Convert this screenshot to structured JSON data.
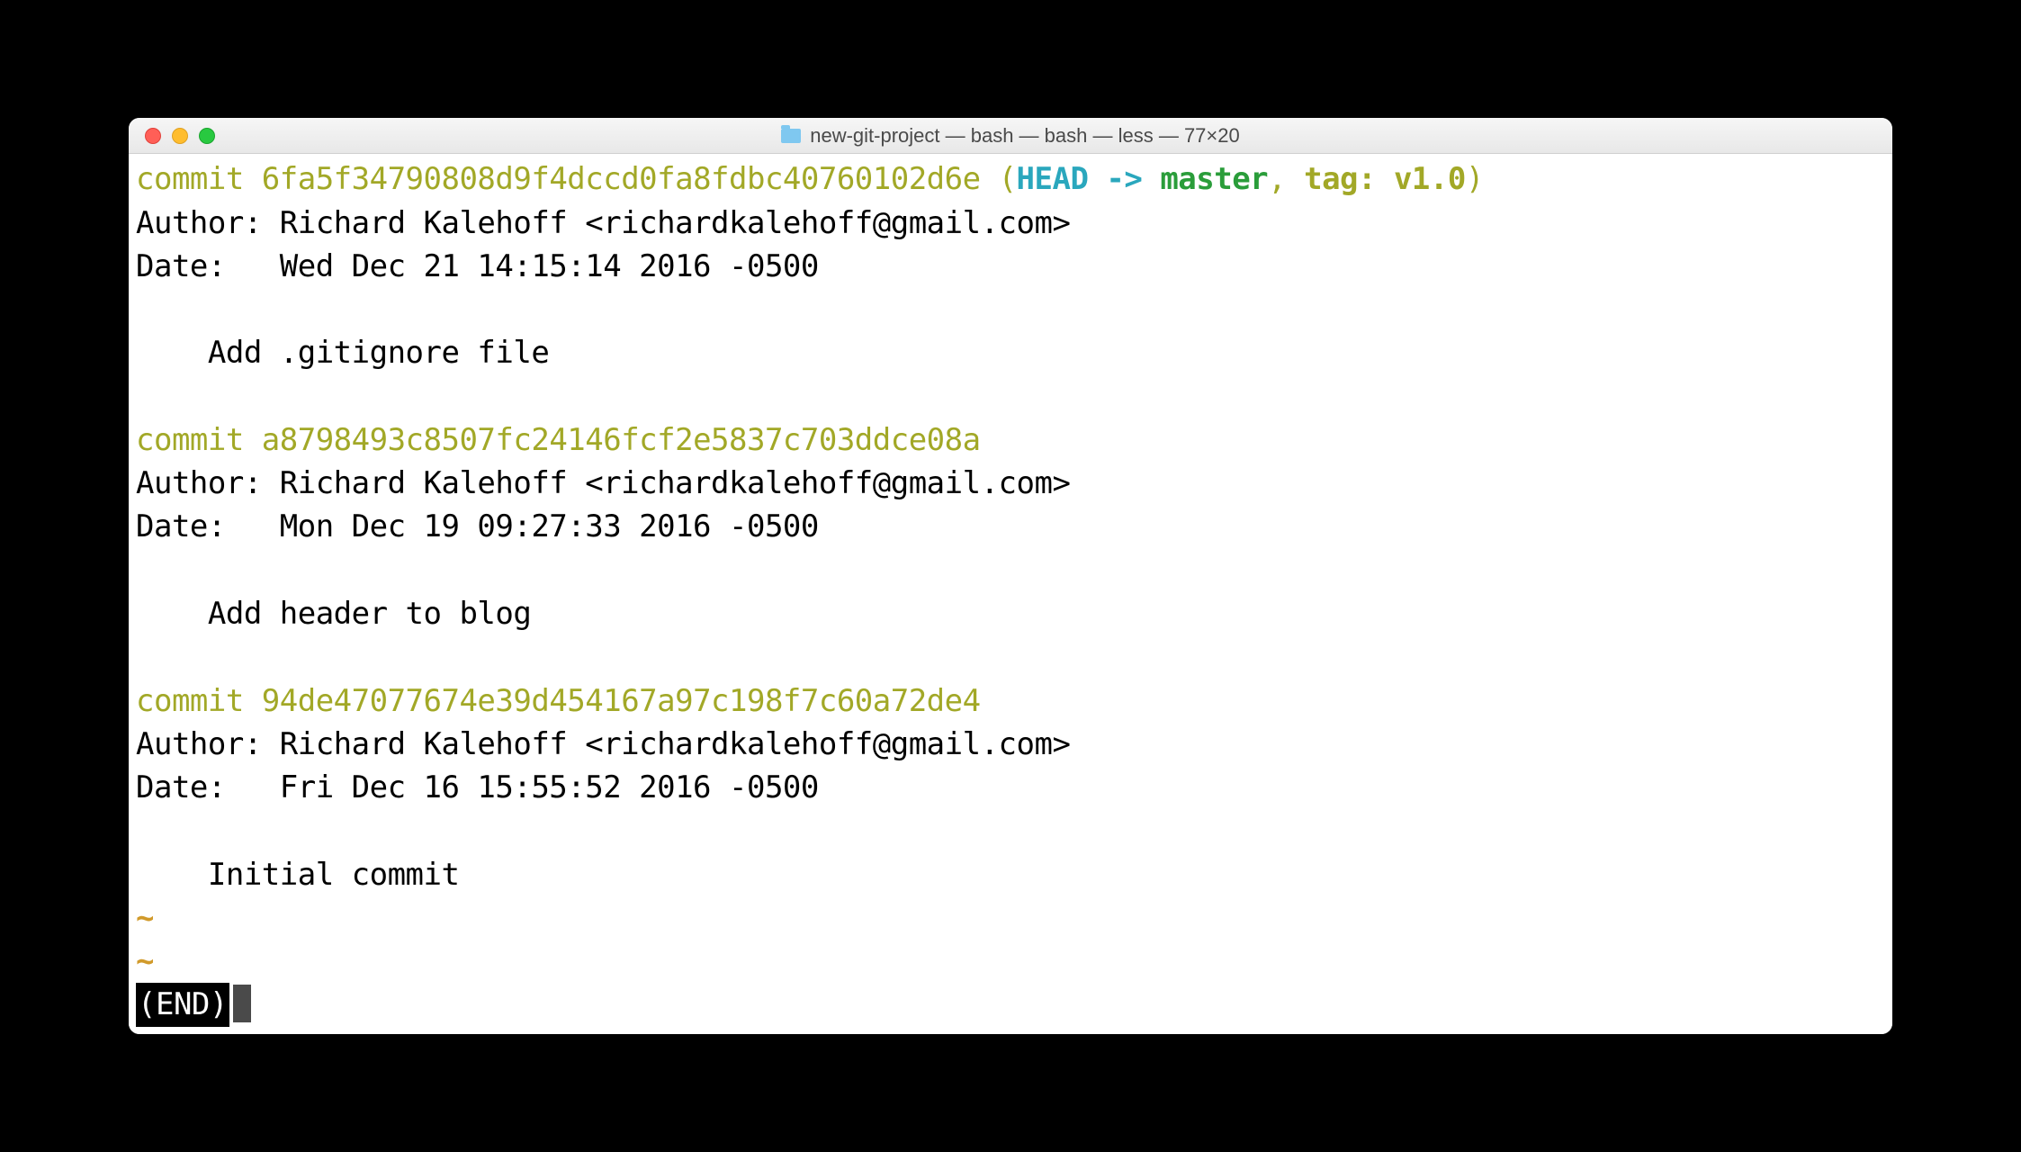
{
  "window": {
    "title": "new-git-project — bash — bash — less — 77×20"
  },
  "commits": [
    {
      "line_prefix": "commit ",
      "hash": "6fa5f34790808d9f4dccd0fa8fdbc40760102d6e",
      "refs": {
        "open": " (",
        "head": "HEAD -> ",
        "branch": "master",
        "sep": ", ",
        "tag_label": "tag: ",
        "tag": "v1.0",
        "close": ")"
      },
      "author_line": "Author: Richard Kalehoff <richardkalehoff@gmail.com>",
      "date_line": "Date:   Wed Dec 21 14:15:14 2016 -0500",
      "message": "    Add .gitignore file"
    },
    {
      "line_prefix": "commit ",
      "hash": "a8798493c8507fc24146fcf2e5837c703ddce08a",
      "author_line": "Author: Richard Kalehoff <richardkalehoff@gmail.com>",
      "date_line": "Date:   Mon Dec 19 09:27:33 2016 -0500",
      "message": "    Add header to blog"
    },
    {
      "line_prefix": "commit ",
      "hash": "94de47077674e39d454167a97c198f7c60a72de4",
      "author_line": "Author: Richard Kalehoff <richardkalehoff@gmail.com>",
      "date_line": "Date:   Fri Dec 16 15:55:52 2016 -0500",
      "message": "    Initial commit"
    }
  ],
  "pager": {
    "tilde": "~",
    "end": "(END)"
  }
}
